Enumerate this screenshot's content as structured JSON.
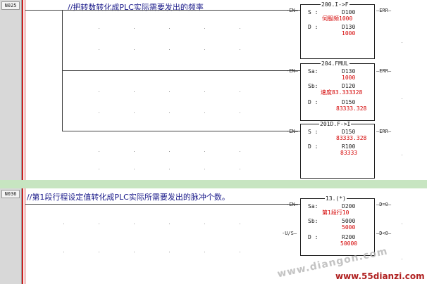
{
  "rung1": {
    "number": "N025",
    "comment": "//把转数转化成PLC实际需要发出的频率",
    "blocks": [
      {
        "title": "200.I->F",
        "in": "EN",
        "out": "ERR",
        "rows": [
          {
            "label": "S :",
            "value": "D100",
            "value_color": "dark",
            "sub": "伺服频1000",
            "sub_color": "red"
          },
          {
            "label": "D :",
            "value": "D130",
            "value_color": "dark",
            "sub": "1000",
            "sub_color": "red"
          }
        ]
      },
      {
        "title": "204.FMUL",
        "in": "EN",
        "out": "ERR",
        "rows": [
          {
            "label": "Sa:",
            "value": "D130",
            "value_color": "dark",
            "sub": "1000",
            "sub_color": "red"
          },
          {
            "label": "Sb:",
            "value": "D120",
            "value_color": "dark",
            "sub": "速度83.333328",
            "sub_color": "red"
          },
          {
            "label": "D :",
            "value": "D150",
            "value_color": "dark",
            "sub": "83333.328",
            "sub_color": "red"
          }
        ]
      },
      {
        "title": "201D.F->I",
        "in": "EN",
        "out": "ERR",
        "rows": [
          {
            "label": "S :",
            "value": "D150",
            "value_color": "dark",
            "sub": "83333.328",
            "sub_color": "red"
          },
          {
            "label": "D :",
            "value": "R100",
            "value_color": "dark",
            "sub": "83333",
            "sub_color": "red"
          }
        ]
      }
    ]
  },
  "rung2": {
    "number": "N036",
    "comment": "//第1段行程设定值转化成PLC实际所需要发出的脉冲个数。",
    "block": {
      "title": "13.(*)",
      "in": "EN",
      "in2": "U/S",
      "out1": "D=0",
      "out2": "D<0",
      "rows": [
        {
          "label": "Sa:",
          "value": "D200",
          "sub": "第1段行10"
        },
        {
          "label": "Sb:",
          "value": "5000",
          "sub": "5000"
        },
        {
          "label": "D :",
          "value": "R200",
          "sub": "50000"
        }
      ]
    }
  },
  "watermark": {
    "site_faded": "www.diangon.com",
    "site": "www.55dianzi.com"
  },
  "colors": {
    "separator": "#c7e5c1",
    "value_red": "#d40000",
    "rail_red": "#cc2020",
    "comment_blue": "#1a1a8a"
  }
}
